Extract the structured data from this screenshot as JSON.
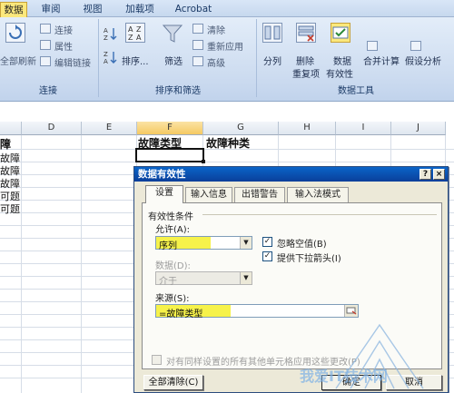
{
  "ribbon": {
    "tabs": [
      "数据",
      "审阅",
      "视图",
      "加载项",
      "Acrobat"
    ],
    "active_tab": "数据",
    "groups": {
      "connections": {
        "title": "连接",
        "refresh_label": "全部刷新",
        "items": [
          "连接",
          "属性",
          "编辑链接"
        ]
      },
      "sort_filter": {
        "title": "排序和筛选",
        "sort_label": "排序...",
        "filter_label": "筛选",
        "items": [
          "清除",
          "重新应用",
          "高级"
        ]
      },
      "data_tools": {
        "title": "数据工具",
        "split_label": "分列",
        "remove_dup_label": "删除",
        "remove_dup_label2": "重复项",
        "validation_label": "数据",
        "validation_label2": "有效性",
        "consolidate_label": "合并计算",
        "whatif_label": "假设分析"
      }
    }
  },
  "sheet": {
    "columns": [
      "D",
      "E",
      "F",
      "G",
      "H",
      "I",
      "J"
    ],
    "selected_column": "F",
    "left_cells": [
      "障",
      "故障",
      "故障",
      "故障",
      "可题",
      "可题"
    ],
    "f1_header": "故障类型",
    "g1_header": "故障种类"
  },
  "dialog": {
    "title": "数据有效性",
    "help_button": "?",
    "close_button": "×",
    "tabs": [
      "设置",
      "输入信息",
      "出错警告",
      "输入法模式"
    ],
    "active_tab": "设置",
    "section_label": "有效性条件",
    "allow_label": "允许(A):",
    "allow_value": "序列",
    "data_label": "数据(D):",
    "data_value": "介于",
    "ignore_blank_label": "忽略空值(B)",
    "ignore_blank_checked": true,
    "dropdown_label": "提供下拉箭头(I)",
    "dropdown_checked": true,
    "source_label": "来源(S):",
    "source_value": "=故障类型",
    "apply_all_label": "对有同样设置的所有其他单元格应用这些更改(P)",
    "clear_button": "全部清除(C)",
    "ok_button": "确定",
    "cancel_button": "取消"
  },
  "watermark": {
    "text": "我爱IT技术网"
  },
  "colors": {
    "active_tab": "#fbe87c",
    "highlight": "#f6f24a",
    "title_bar": "#0a64c8"
  }
}
